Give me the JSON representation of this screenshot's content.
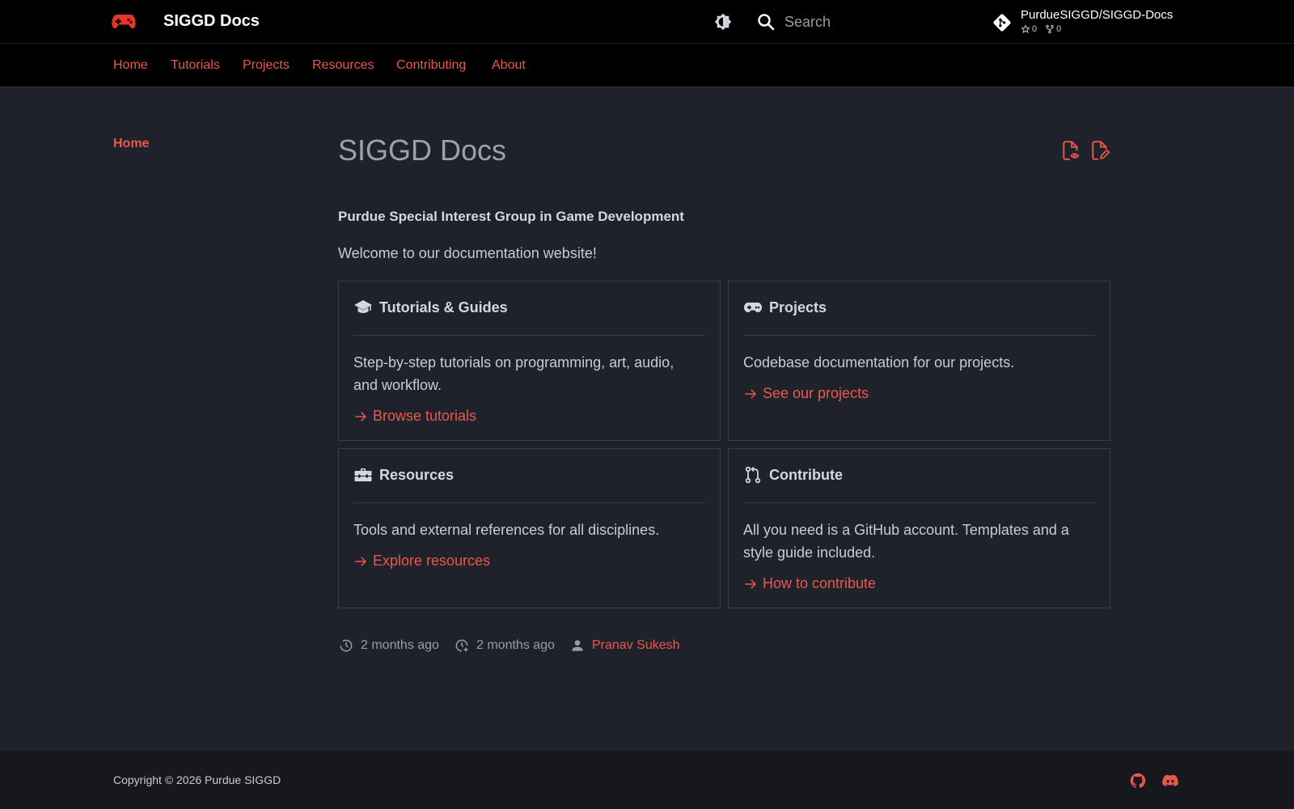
{
  "header": {
    "logo_icon": "gamepad-icon",
    "site_title": "SIGGD Docs",
    "theme_toggle_icon": "brightness-icon",
    "search": {
      "placeholder": "Search",
      "value": ""
    },
    "repo": {
      "name": "PurdueSIGGD/SIGGD-Docs",
      "stars": "0",
      "forks": "0",
      "icon": "git-icon"
    }
  },
  "tabs": [
    "Home",
    "Tutorials",
    "Projects",
    "Resources",
    "Contributing",
    "About"
  ],
  "sidebar": {
    "home_label": "Home"
  },
  "content": {
    "title": "SIGGD Docs",
    "subtitle": "Purdue Special Interest Group in Game Development",
    "welcome": "Welcome to our documentation website!",
    "cards": [
      {
        "icon": "graduation-cap-icon",
        "title": "Tutorials & Guides",
        "description": "Step-by-step tutorials on programming, art, audio, and workflow.",
        "link": "Browse tutorials"
      },
      {
        "icon": "gamepad-icon",
        "title": "Projects",
        "description": "Codebase documentation for our projects.",
        "link": "See our projects"
      },
      {
        "icon": "toolbox-icon",
        "title": "Resources",
        "description": "Tools and external references for all disciplines.",
        "link": "Explore resources"
      },
      {
        "icon": "pull-request-icon",
        "title": "Contribute",
        "description": "All you need is a GitHub account. Templates and a style guide included.",
        "link": "How to contribute"
      }
    ],
    "meta": {
      "updated": "2 months ago",
      "created": "2 months ago",
      "author": "Pranav Sukesh"
    }
  },
  "footer": {
    "copyright": "Copyright © 2026 Purdue SIGGD",
    "icons": [
      "github-icon",
      "discord-icon"
    ]
  },
  "colors": {
    "accent": "#e8594b",
    "header_bg": "#000000",
    "page_bg": "#20222b",
    "footer_bg": "#17181d"
  }
}
